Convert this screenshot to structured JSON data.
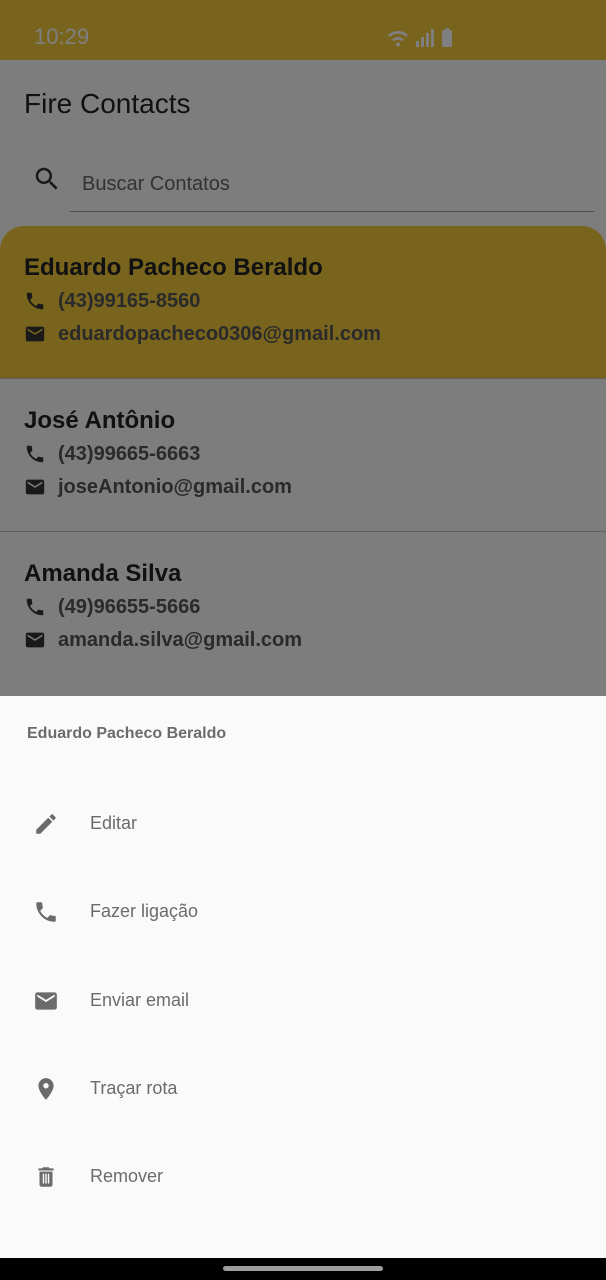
{
  "status_bar": {
    "time": "10:29",
    "icons": [
      "wifi-icon",
      "signal-icon",
      "battery-icon"
    ]
  },
  "app": {
    "title": "Fire Contacts"
  },
  "search": {
    "placeholder": "Buscar Contatos",
    "value": ""
  },
  "contacts": [
    {
      "name": "Eduardo Pacheco Beraldo",
      "phone": "(43)99165-8560",
      "email": "eduardopacheco0306@gmail.com",
      "selected": true
    },
    {
      "name": "José Antônio",
      "phone": "(43)99665-6663",
      "email": "joseAntonio@gmail.com",
      "selected": false
    },
    {
      "name": "Amanda Silva",
      "phone": "(49)96655-5666",
      "email": "amanda.silva@gmail.com",
      "selected": false
    }
  ],
  "sheet": {
    "title": "Eduardo Pacheco Beraldo",
    "actions": [
      {
        "label": "Editar",
        "icon": "pencil-icon"
      },
      {
        "label": "Fazer ligação",
        "icon": "phone-icon"
      },
      {
        "label": "Enviar email",
        "icon": "email-icon"
      },
      {
        "label": "Traçar rota",
        "icon": "map-pin-icon"
      },
      {
        "label": "Remover",
        "icon": "trash-icon"
      }
    ]
  },
  "colors": {
    "accent": "#f0c93a",
    "scrim": "rgba(0,0,0,0.5)",
    "sheet_bg": "#fafafa",
    "text_muted": "#6b6b6b"
  }
}
